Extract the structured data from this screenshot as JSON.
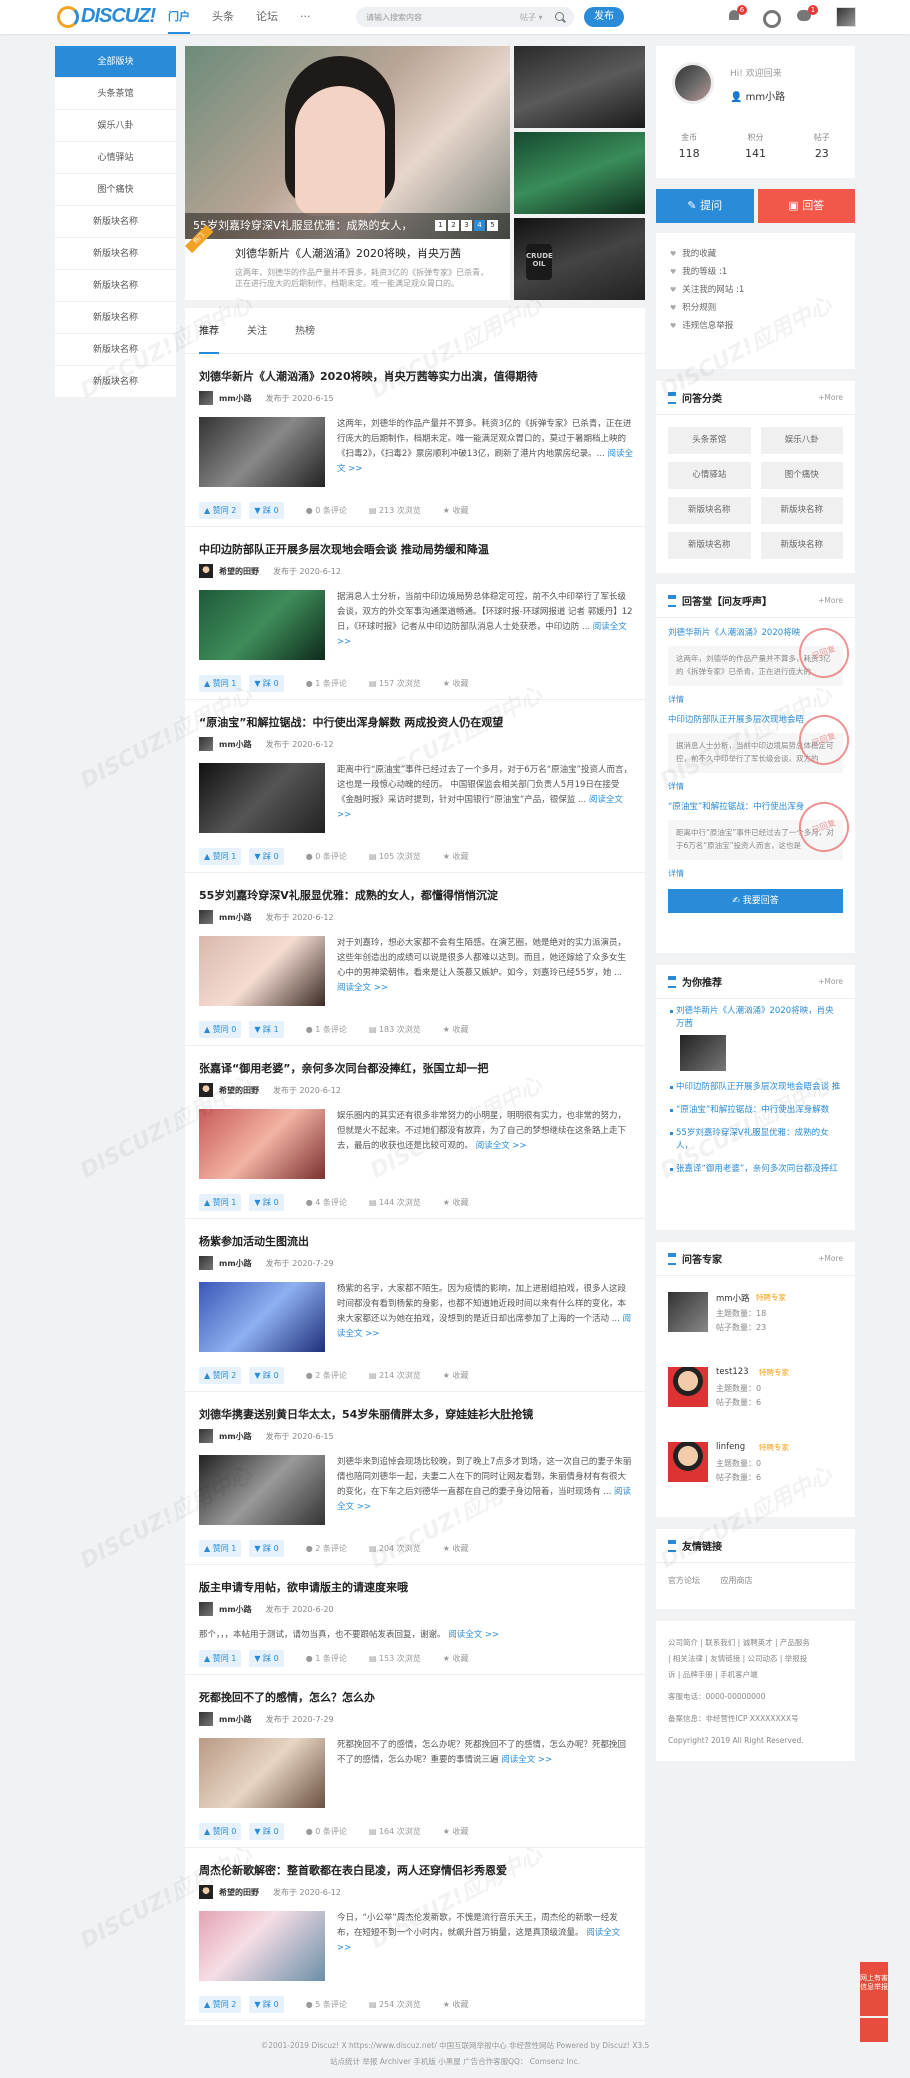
{
  "header": {
    "logo_text": "DISCUZ!",
    "nav": [
      "门户",
      "头条",
      "论坛",
      "···"
    ],
    "search_placeholder": "请输入搜索内容",
    "search_scope": "帖子 ▾",
    "publish": "发布",
    "bell_badge": "6",
    "chat_badge": "1"
  },
  "leftnav": [
    "全部版块",
    "头条茶馆",
    "娱乐八卦",
    "心情驿站",
    "图个痛快",
    "新版块名称",
    "新版块名称",
    "新版块名称",
    "新版块名称",
    "新版块名称",
    "新版块名称"
  ],
  "slider": {
    "caption": "55岁刘嘉玲穿深V礼服显优雅：成熟的女人，",
    "pages": [
      "1",
      "2",
      "3",
      "4",
      "5"
    ],
    "active": 3,
    "ribbon": "热门",
    "title": "刘德华新片《人潮汹涌》2020将映，肖央万茜",
    "desc": "这两年，刘德华的作品产量并不算多，耗资3亿的《拆弹专家》已杀青，正在进行庞大的后期制作，档期未定。唯一能满足观众胃口的。"
  },
  "thumbs": [
    "CRUDE OIL"
  ],
  "tabs": [
    "推荐",
    "关注",
    "热榜"
  ],
  "posts": [
    {
      "title": "刘德华新片《人潮汹涌》2020将映，肖央万茜等实力出演，值得期待",
      "author": "mm小路",
      "date": "发布于 2020-6-15",
      "excerpt": "这两年，刘德华的作品产量并不算多。耗资3亿的《拆弹专家》已杀青，正在进行庞大的后期制作，档期未定。唯一能满足观众胃口的，莫过于暑期档上映的《扫毒2》，《扫毒2》票房顺利冲破13亿，刷新了港片内地票房纪录。...",
      "up": "赞同 2",
      "down": "踩 0",
      "comments": "0 条评论",
      "views": "213 次浏览",
      "fav": "收藏",
      "img": "linear-gradient(135deg,#333,#888 50%,#222)"
    },
    {
      "title": "中印边防部队正开展多层次现地会晤会谈 推动局势缓和降温",
      "author": "希望的田野",
      "date": "发布于 2020-6-12",
      "excerpt": "据消息人士分析，当前中印边境局势总体稳定可控，前不久中印举行了军长级会谈，双方的外交军事沟通渠道畅通。【环球时报-环球网报道 记者 郭媛丹】12日，《环球时报》记者从中印边防部队消息人士处获悉，中印边防 ...",
      "up": "赞同 1",
      "down": "踩 0",
      "comments": "1 条评论",
      "views": "157 次浏览",
      "fav": "收藏",
      "img": "linear-gradient(135deg,#1f5a3a,#3e8d5a 50%,#0e2a1b)"
    },
    {
      "title": "“原油宝”和解拉锯战：中行使出浑身解数 两成投资人仍在观望",
      "author": "mm小路",
      "date": "发布于 2020-6-12",
      "excerpt": "距离中行“原油宝”事件已经过去了一个多月，对于6万名“原油宝”投资人而言，这也是一段惊心动魄的经历。 中国银保监会相关部门负责人5月19日在接受《金融时报》采访时提到，针对中国银行“原油宝”产品，银保监 ...",
      "up": "赞同 1",
      "down": "踩 0",
      "comments": "0 条评论",
      "views": "105 次浏览",
      "fav": "收藏",
      "img": "linear-gradient(135deg,#111,#555 50%,#222)"
    },
    {
      "title": "55岁刘嘉玲穿深V礼服显优雅：成熟的女人，都懂得悄悄沉淀",
      "author": "mm小路",
      "date": "发布于 2020-6-12",
      "excerpt": "对于刘嘉玲，想必大家都不会有生陌感。在演艺圈，她是绝对的实力派演员，这些年创造出的成绩可以说是很多人都难以达到。而且，她还嫁给了众多女生心中的男神梁朝伟，看来是让人羡慕又嫉妒。如今，刘嘉玲已经55岁，她 ...",
      "up": "赞同 0",
      "down": "踩 1",
      "comments": "1 条评论",
      "views": "183 次浏览",
      "fav": "收藏",
      "img": "linear-gradient(135deg,#d8b8ad,#f5dcd2 50%,#3a2a24)"
    },
    {
      "title": "张嘉译“御用老婆”，亲何多次同台都没捧红，张国立却一把",
      "author": "希望的田野",
      "date": "发布于 2020-6-12",
      "excerpt": "娱乐圈内的其实还有很多非常努力的小明星，明明很有实力，也非常的努力，但就是火不起来。不过她们都没有放弃，为了自己的梦想继续在这条路上走下去，最后的收获也还是比较可观的。",
      "up": "赞同 1",
      "down": "踩 0",
      "comments": "4 条评论",
      "views": "144 次浏览",
      "fav": "收藏",
      "img": "linear-gradient(135deg,#c85a5a,#f3b3a3 50%,#7a3030)"
    },
    {
      "title": "杨紫参加活动生图流出",
      "author": "mm小路",
      "date": "发布于 2020-7-29",
      "excerpt": "杨紫的名字，大家都不陌生。因为疫情的影响，加上进剧组拍戏，很多人这段时间都没有看到杨紫的身影，也都不知道她近段时间以来有什么样的变化，本来大家都还以为她在拍戏，没想到的是近日却出席参加了上海的一个活动 ...",
      "up": "赞同 2",
      "down": "踩 0",
      "comments": "2 条评论",
      "views": "214 次浏览",
      "fav": "收藏",
      "img": "linear-gradient(135deg,#3a57b8,#8fb0f0 50%,#1d2f7a)"
    },
    {
      "title": "刘德华携妻送别黄日华太太，54岁朱丽倩胖太多，穿娃娃衫大肚抢镜",
      "author": "mm小路",
      "date": "发布于 2020-6-15",
      "excerpt": "刘德华来到追悼会现场比较晚，到了晚上7点多才到场，这一次自己的妻子朱丽倩也陪同刘德华一起，夫妻二人在下的同时让网友看到，朱丽倩身材有有很大的变化，在下车之后刘德华一直都在自己的妻子身边陪着，当时现场有 ...",
      "up": "赞同 1",
      "down": "踩 0",
      "comments": "2 条评论",
      "views": "204 次浏览",
      "fav": "收藏",
      "img": "linear-gradient(135deg,#222,#999 50%,#333)"
    },
    {
      "title": "版主申请专用帖，欲申请版主的请速度来哦",
      "author": "mm小路",
      "date": "发布于 2020-6-20",
      "excerpt": "那个，，，本帖用于测试，请勿当真，也不要跟帖发表回复，谢谢。",
      "up": "赞同 1",
      "down": "踩 0",
      "comments": "1 条评论",
      "views": "153 次浏览",
      "fav": "收藏",
      "img": ""
    },
    {
      "title": "死都挽回不了的感情，怎么？怎么办",
      "author": "mm小路",
      "date": "发布于 2020-7-29",
      "excerpt": "死都挽回不了的感情，怎么办呢？死都挽回不了的感情，怎么办呢？死都挽回不了的感情，怎么办呢？重要的事情说三遍",
      "up": "赞同 0",
      "down": "踩 0",
      "comments": "0 条评论",
      "views": "164 次浏览",
      "fav": "收藏",
      "img": "linear-gradient(135deg,#b89a85,#e8d5c4 50%,#6a5040)"
    },
    {
      "title": "周杰伦新歌解密：整首歌都在表白昆凌，两人还穿情侣衫秀恩爱",
      "author": "希望的田野",
      "date": "发布于 2020-6-12",
      "excerpt": "今日，“小公举”周杰伦发新歌，不愧是流行音乐天王，周杰伦的新歌一经发布，在短短不到一个小时内，就飙升首万销量，这是真顶级流量。",
      "up": "赞同 2",
      "down": "踩 0",
      "comments": "5 条评论",
      "views": "254 次浏览",
      "fav": "收藏",
      "img": "linear-gradient(135deg,#e4a3b3,#f6dde5 40%,#6b8fa8)"
    }
  ],
  "read_more": "阅读全文 >>",
  "profile": {
    "hi": "Hi! 欢迎回来",
    "name": "mm小路",
    "stats": [
      {
        "label": "金币",
        "value": "118"
      },
      {
        "label": "积分",
        "value": "141"
      },
      {
        "label": "帖子",
        "value": "23"
      }
    ]
  },
  "qa": {
    "ask": "提问",
    "answer": "回答"
  },
  "menu": [
    "我的收藏",
    "我的等级 :1",
    "关注我的网站 :1",
    "积分规则",
    "违规信息举报"
  ],
  "categories": {
    "title": "问答分类",
    "more": "+More",
    "items": [
      "头条茶馆",
      "娱乐八卦",
      "心情驿站",
      "图个痛快",
      "新版块名称",
      "新版块名称",
      "新版块名称",
      "新版块名称"
    ]
  },
  "hotqa": {
    "title": "回答堂【问友呼声】",
    "more": "+More",
    "items": [
      {
        "q": "刘德华新片《人潮汹涌》2020将映",
        "b": "这两年，刘德华的作品产量并不算多，耗资3亿的《拆弹专家》已杀青，正在进行庞大的",
        "d": "详情",
        "stamp": "已回复"
      },
      {
        "q": "中印边防部队正开展多层次现地会晤",
        "b": "据消息人士分析，当前中印边境局势总体稳定可控，前不久中印举行了军长级会谈，双方的",
        "d": "详情",
        "stamp": "已回复"
      },
      {
        "q": "“原油宝”和解拉锯战：中行使出浑身",
        "b": "距离中行“原油宝”事件已经过去了一个多月，对于6万名“原油宝”投资人而言，这也是",
        "d": "详情",
        "stamp": "已回复"
      }
    ],
    "reply": "我要回答"
  },
  "recommend": {
    "title": "为你推荐",
    "more": "+More",
    "items": [
      "刘德华新片《人潮汹涌》2020将映，肖央万茜",
      "中印边防部队正开展多层次现地会晤会谈 推",
      "“原油宝”和解拉锯战：中行使出浑身解数",
      "55岁刘嘉玲穿深V礼服显优雅：成熟的女人，",
      "张嘉译“御用老婆”，亲何多次同台都没捧红"
    ]
  },
  "experts": {
    "title": "问答专家",
    "more": "+More",
    "items": [
      {
        "name": "mm小路",
        "tag": "特聘专家",
        "s1": "主题数量：18",
        "s2": "帖子数量：23"
      },
      {
        "name": "test123",
        "tag": "特聘专家",
        "s1": "主题数量：0",
        "s2": "帖子数量：6"
      },
      {
        "name": "linfeng",
        "tag": "特聘专家",
        "s1": "主题数量：0",
        "s2": "帖子数量：6"
      }
    ]
  },
  "links": {
    "title": "友情链接",
    "items": [
      "官方论坛",
      "应用商店"
    ]
  },
  "footer": {
    "l1": "公司简介 | 联系我们 | 诚聘英才 | 产品服务",
    "l2": "| 相关法律 | 友情链接 | 公司动态 | 举报投",
    "l3": "诉 | 品牌手册 | 手机客户端",
    "tel": "客服电话：0000-00000000",
    "icp": "备案信息：非经营性ICP XXXXXXXX号",
    "copy": "Copyright? 2019 All Right Reserved."
  },
  "copyright1": "©2001-2019 Discuz! X https://www.discuz.net/  中国互联网举报中心  非经营性网站  Powered by Discuz! X3.5",
  "copyright2": "站点统计  举报  Archiver  手机版  小黑屋  广告合作客服QQ：  Comsenz Inc.",
  "float_btn": "网上有害信息举报",
  "watermark": "DISCUZ!应用中心"
}
